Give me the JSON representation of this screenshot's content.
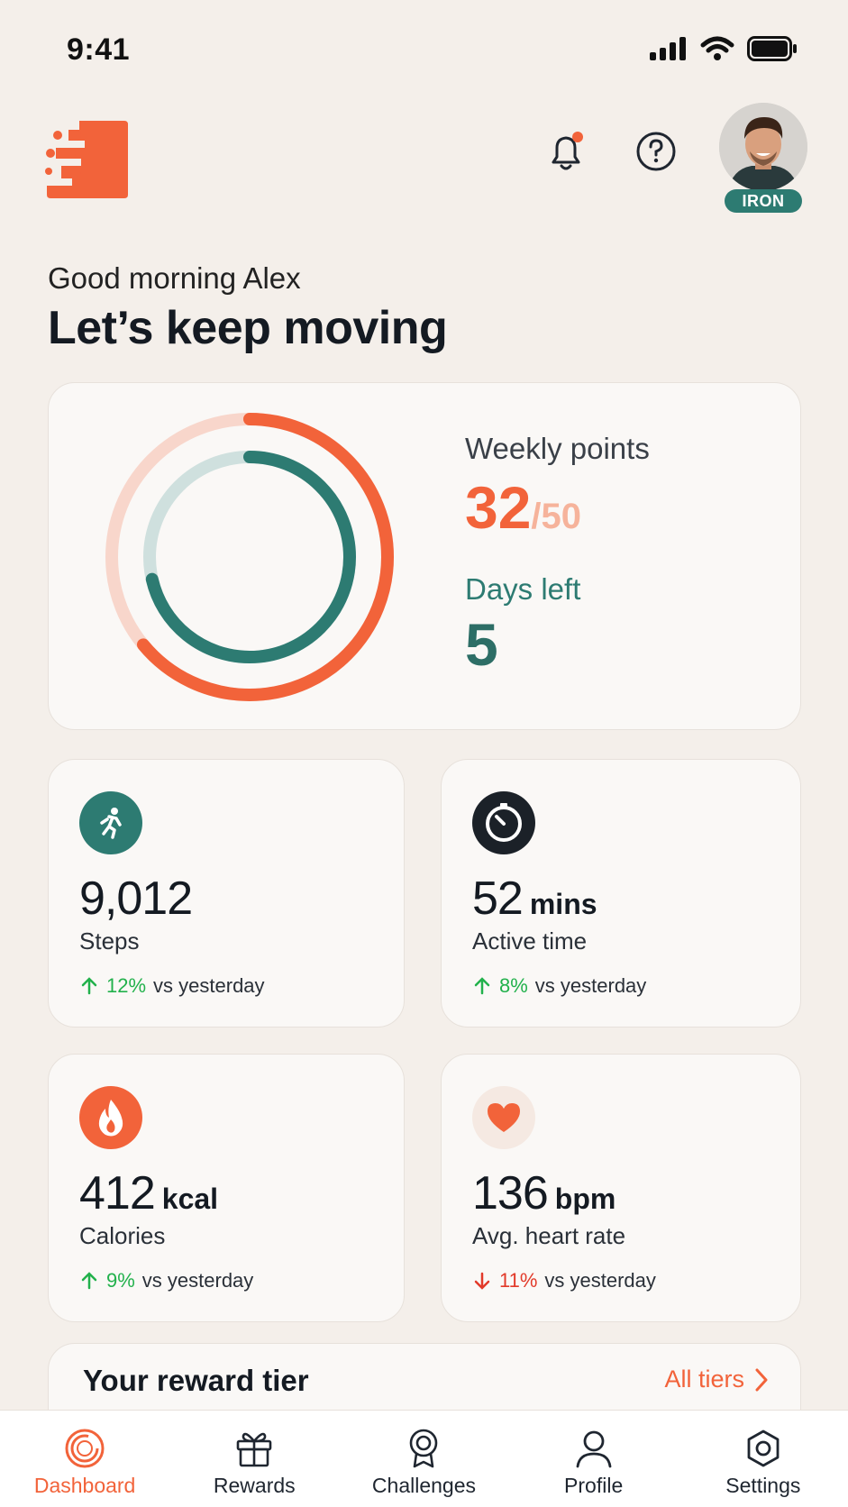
{
  "status_bar": {
    "time": "9:41"
  },
  "header": {
    "tier_badge": "IRON"
  },
  "greeting": {
    "line1": "Good morning Alex",
    "headline": "Let’s keep moving"
  },
  "weekly": {
    "label": "Weekly points",
    "current": "32",
    "goal": "/50",
    "days_label": "Days left",
    "days_value": "5",
    "points_progress": 0.64,
    "days_progress": 0.714
  },
  "stats": [
    {
      "value": "9,012",
      "unit": "",
      "label": "Steps",
      "trend_pct": "12%",
      "trend_text": "vs yesterday",
      "trend_dir": "up",
      "icon": "running-icon"
    },
    {
      "value": "52",
      "unit": "mins",
      "label": "Active time",
      "trend_pct": "8%",
      "trend_text": "vs yesterday",
      "trend_dir": "up",
      "icon": "timer-icon"
    },
    {
      "value": "412",
      "unit": "kcal",
      "label": "Calories",
      "trend_pct": "9%",
      "trend_text": "vs yesterday",
      "trend_dir": "up",
      "icon": "flame-icon"
    },
    {
      "value": "136",
      "unit": "bpm",
      "label": "Avg. heart rate",
      "trend_pct": "11%",
      "trend_text": "vs yesterday",
      "trend_dir": "down",
      "icon": "heart-icon"
    }
  ],
  "reward_tier": {
    "title": "Your reward tier",
    "link": "All tiers"
  },
  "tabs": [
    {
      "label": "Dashboard",
      "icon": "dashboard-icon"
    },
    {
      "label": "Rewards",
      "icon": "gift-icon"
    },
    {
      "label": "Challenges",
      "icon": "medal-icon"
    },
    {
      "label": "Profile",
      "icon": "person-icon"
    },
    {
      "label": "Settings",
      "icon": "gear-icon"
    }
  ],
  "colors": {
    "accent": "#f2633a",
    "teal": "#2d7b72",
    "up": "#22b14c",
    "down": "#e23a2a",
    "background": "#f4efea"
  }
}
